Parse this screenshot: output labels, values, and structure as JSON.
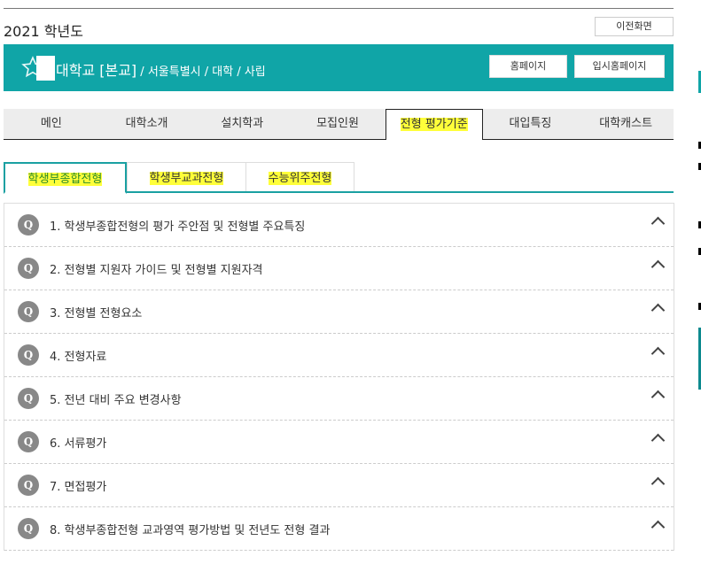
{
  "header": {
    "year": "2021 학년도",
    "prev_button": "이전화면"
  },
  "banner": {
    "university": "대학교 [본교]",
    "location": " / 서울특별시 / 대학 / 사립",
    "homepage_button": "홈페이지",
    "admission_homepage_button": "입시홈페이지"
  },
  "nav": [
    "메인",
    "대학소개",
    "설치학과",
    "모집인원",
    "전형 평가기준",
    "대입특징",
    "대학캐스트"
  ],
  "subtabs": [
    "학생부종합전형",
    "학생부교과전형",
    "수능위주전형"
  ],
  "faq": {
    "badge": "Q",
    "items": [
      "1. 학생부종합전형의 평가 주안점 및 전형별 주요특징",
      "2. 전형별 지원자 가이드 및 전형별 지원자격",
      "3. 전형별 전형요소",
      "4. 전형자료",
      "5. 전년 대비 주요 변경사항",
      "6. 서류평가",
      "7. 면접평가",
      "8. 학생부종합전형 교과영역 평가방법 및 전년도 전형 결과"
    ]
  },
  "colors": {
    "brand": "#10a5a7",
    "highlight": "#ffff3a"
  }
}
